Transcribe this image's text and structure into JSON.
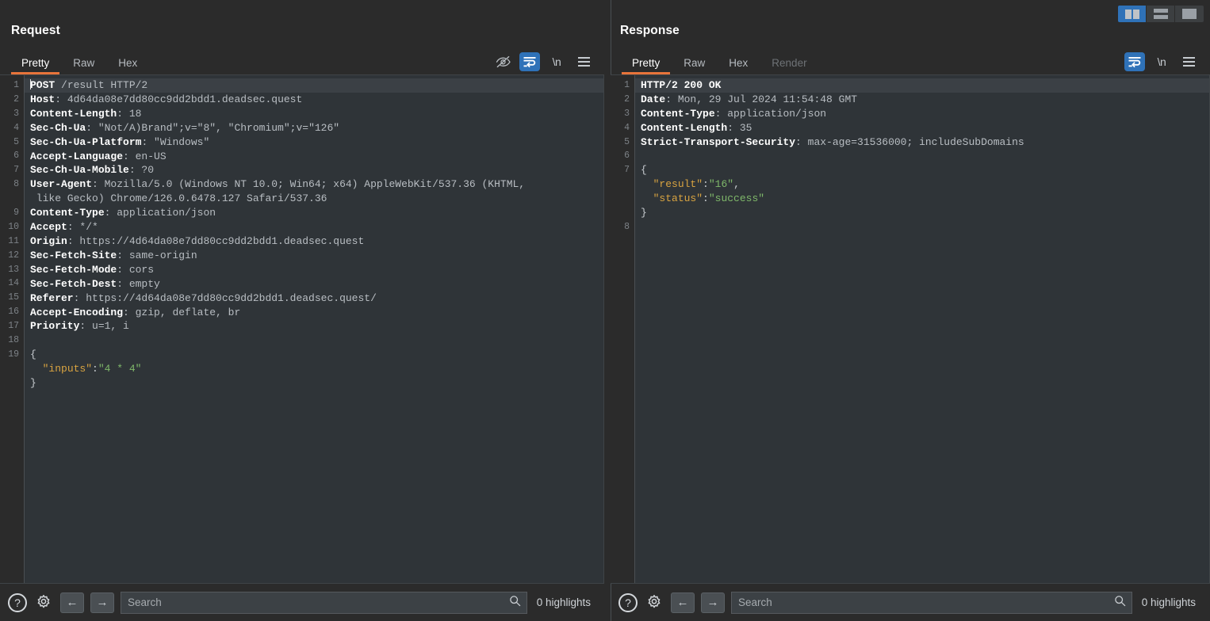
{
  "window": {
    "layout_buttons": [
      {
        "name": "vertical-split",
        "label": "Vertical split",
        "active": true
      },
      {
        "name": "horizontal-split",
        "label": "Horizontal split",
        "active": false
      },
      {
        "name": "single-pane",
        "label": "Single pane",
        "active": false
      }
    ]
  },
  "request": {
    "title": "Request",
    "tabs": [
      {
        "label": "Pretty",
        "active": true,
        "disabled": false
      },
      {
        "label": "Raw",
        "active": false,
        "disabled": false
      },
      {
        "label": "Hex",
        "active": false,
        "disabled": false
      }
    ],
    "toolbar_icons": [
      {
        "name": "eye-off-icon",
        "label": "Hide / show",
        "active": false
      },
      {
        "name": "word-wrap-icon",
        "label": "Word wrap",
        "active": true
      },
      {
        "name": "newline-icon",
        "label": "\\n",
        "active": false
      },
      {
        "name": "menu-icon",
        "label": "Menu",
        "active": false
      }
    ],
    "lines": [
      {
        "num": "1",
        "highlight": true,
        "caret": true,
        "spans": [
          {
            "cls": "hname",
            "t": "POST"
          },
          {
            "cls": "hval",
            "t": " /result HTTP/2"
          }
        ]
      },
      {
        "num": "2",
        "spans": [
          {
            "cls": "hname",
            "t": "Host"
          },
          {
            "cls": "hval",
            "t": ": 4d64da08e7dd80cc9dd2bdd1.deadsec.quest"
          }
        ]
      },
      {
        "num": "3",
        "spans": [
          {
            "cls": "hname",
            "t": "Content-Length"
          },
          {
            "cls": "hval",
            "t": ": 18"
          }
        ]
      },
      {
        "num": "4",
        "spans": [
          {
            "cls": "hname",
            "t": "Sec-Ch-Ua"
          },
          {
            "cls": "hval",
            "t": ": \"Not/A)Brand\";v=\"8\", \"Chromium\";v=\"126\""
          }
        ]
      },
      {
        "num": "5",
        "spans": [
          {
            "cls": "hname",
            "t": "Sec-Ch-Ua-Platform"
          },
          {
            "cls": "hval",
            "t": ": \"Windows\""
          }
        ]
      },
      {
        "num": "6",
        "spans": [
          {
            "cls": "hname",
            "t": "Accept-Language"
          },
          {
            "cls": "hval",
            "t": ": en-US"
          }
        ]
      },
      {
        "num": "7",
        "spans": [
          {
            "cls": "hname",
            "t": "Sec-Ch-Ua-Mobile"
          },
          {
            "cls": "hval",
            "t": ": ?0"
          }
        ]
      },
      {
        "num": "8",
        "spans": [
          {
            "cls": "hname",
            "t": "User-Agent"
          },
          {
            "cls": "hval",
            "t": ": Mozilla/5.0 (Windows NT 10.0; Win64; x64) AppleWebKit/537.36 (KHTML,"
          }
        ]
      },
      {
        "num": "",
        "spans": [
          {
            "cls": "hval",
            "t": " like Gecko) Chrome/126.0.6478.127 Safari/537.36"
          }
        ]
      },
      {
        "num": "9",
        "spans": [
          {
            "cls": "hname",
            "t": "Content-Type"
          },
          {
            "cls": "hval",
            "t": ": application/json"
          }
        ]
      },
      {
        "num": "10",
        "spans": [
          {
            "cls": "hname",
            "t": "Accept"
          },
          {
            "cls": "hval",
            "t": ": */*"
          }
        ]
      },
      {
        "num": "11",
        "spans": [
          {
            "cls": "hname",
            "t": "Origin"
          },
          {
            "cls": "hval",
            "t": ": https://4d64da08e7dd80cc9dd2bdd1.deadsec.quest"
          }
        ]
      },
      {
        "num": "12",
        "spans": [
          {
            "cls": "hname",
            "t": "Sec-Fetch-Site"
          },
          {
            "cls": "hval",
            "t": ": same-origin"
          }
        ]
      },
      {
        "num": "13",
        "spans": [
          {
            "cls": "hname",
            "t": "Sec-Fetch-Mode"
          },
          {
            "cls": "hval",
            "t": ": cors"
          }
        ]
      },
      {
        "num": "14",
        "spans": [
          {
            "cls": "hname",
            "t": "Sec-Fetch-Dest"
          },
          {
            "cls": "hval",
            "t": ": empty"
          }
        ]
      },
      {
        "num": "15",
        "spans": [
          {
            "cls": "hname",
            "t": "Referer"
          },
          {
            "cls": "hval",
            "t": ": https://4d64da08e7dd80cc9dd2bdd1.deadsec.quest/"
          }
        ]
      },
      {
        "num": "16",
        "spans": [
          {
            "cls": "hname",
            "t": "Accept-Encoding"
          },
          {
            "cls": "hval",
            "t": ": gzip, deflate, br"
          }
        ]
      },
      {
        "num": "17",
        "spans": [
          {
            "cls": "hname",
            "t": "Priority"
          },
          {
            "cls": "hval",
            "t": ": u=1, i"
          }
        ]
      },
      {
        "num": "18",
        "spans": [
          {
            "cls": "hval",
            "t": ""
          }
        ]
      },
      {
        "num": "19",
        "spans": [
          {
            "cls": "jpunc",
            "t": "{"
          }
        ]
      },
      {
        "num": "",
        "spans": [
          {
            "cls": "jpunc",
            "t": "  "
          },
          {
            "cls": "jkey",
            "t": "\"inputs\""
          },
          {
            "cls": "jpunc",
            "t": ":"
          },
          {
            "cls": "jstr",
            "t": "\"4 * 4\""
          }
        ]
      },
      {
        "num": "",
        "spans": [
          {
            "cls": "jpunc",
            "t": "}"
          }
        ]
      }
    ],
    "footer": {
      "help_label": "?",
      "back_label": "←",
      "forward_label": "→",
      "search_placeholder": "Search",
      "search_value": "",
      "highlights_label": "0 highlights"
    }
  },
  "response": {
    "title": "Response",
    "tabs": [
      {
        "label": "Pretty",
        "active": true,
        "disabled": false
      },
      {
        "label": "Raw",
        "active": false,
        "disabled": false
      },
      {
        "label": "Hex",
        "active": false,
        "disabled": false
      },
      {
        "label": "Render",
        "active": false,
        "disabled": true
      }
    ],
    "toolbar_icons": [
      {
        "name": "word-wrap-icon",
        "label": "Word wrap",
        "active": true
      },
      {
        "name": "newline-icon",
        "label": "\\n",
        "active": false
      },
      {
        "name": "menu-icon",
        "label": "Menu",
        "active": false
      }
    ],
    "lines": [
      {
        "num": "1",
        "highlight": true,
        "spans": [
          {
            "cls": "hname",
            "t": "HTTP/2 200 OK"
          }
        ]
      },
      {
        "num": "2",
        "spans": [
          {
            "cls": "hname",
            "t": "Date"
          },
          {
            "cls": "hval",
            "t": ": Mon, 29 Jul 2024 11:54:48 GMT"
          }
        ]
      },
      {
        "num": "3",
        "spans": [
          {
            "cls": "hname",
            "t": "Content-Type"
          },
          {
            "cls": "hval",
            "t": ": application/json"
          }
        ]
      },
      {
        "num": "4",
        "spans": [
          {
            "cls": "hname",
            "t": "Content-Length"
          },
          {
            "cls": "hval",
            "t": ": 35"
          }
        ]
      },
      {
        "num": "5",
        "spans": [
          {
            "cls": "hname",
            "t": "Strict-Transport-Security"
          },
          {
            "cls": "hval",
            "t": ": max-age=31536000; includeSubDomains"
          }
        ]
      },
      {
        "num": "6",
        "spans": [
          {
            "cls": "hval",
            "t": ""
          }
        ]
      },
      {
        "num": "7",
        "spans": [
          {
            "cls": "jpunc",
            "t": "{"
          }
        ]
      },
      {
        "num": "",
        "spans": [
          {
            "cls": "jpunc",
            "t": "  "
          },
          {
            "cls": "jkey",
            "t": "\"result\""
          },
          {
            "cls": "jpunc",
            "t": ":"
          },
          {
            "cls": "jstr",
            "t": "\"16\""
          },
          {
            "cls": "jpunc",
            "t": ","
          }
        ]
      },
      {
        "num": "",
        "spans": [
          {
            "cls": "jpunc",
            "t": "  "
          },
          {
            "cls": "jkey",
            "t": "\"status\""
          },
          {
            "cls": "jpunc",
            "t": ":"
          },
          {
            "cls": "jstr",
            "t": "\"success\""
          }
        ]
      },
      {
        "num": "",
        "spans": [
          {
            "cls": "jpunc",
            "t": "}"
          }
        ]
      },
      {
        "num": "8",
        "spans": [
          {
            "cls": "hval",
            "t": ""
          }
        ]
      }
    ],
    "footer": {
      "help_label": "?",
      "back_label": "←",
      "forward_label": "→",
      "search_placeholder": "Search",
      "search_value": "",
      "highlights_label": "0 highlights"
    }
  },
  "colors": {
    "background": "#2b2b2b",
    "editor_bg": "#2f3438",
    "accent_tab": "#e8743b",
    "accent_active": "#2f72b8",
    "json_key": "#d9a441",
    "json_string": "#7fb86a"
  }
}
